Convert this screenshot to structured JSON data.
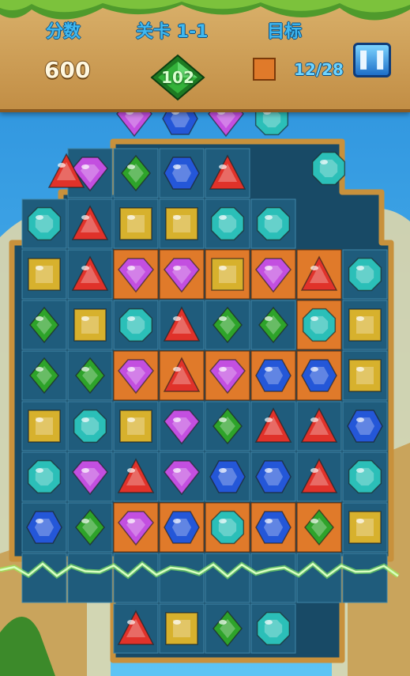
{
  "header": {
    "score_label": "分数",
    "score_value": "600",
    "level_label": "关卡 1-1",
    "goal_label": "目标",
    "moves_left": "102",
    "goal_progress": "12/28",
    "pause_icon": "pause-icon"
  },
  "colors": {
    "purple": "#c34fe0",
    "blue": "#2457d8",
    "teal": "#2bbfb8",
    "red": "#e0322a",
    "green": "#2ea32a",
    "yellow": "#d7b12d",
    "orange_tile": "#e07a2a",
    "board_cell": "#1f5c7c"
  },
  "board": {
    "grid": [
      ".PGBR..",
      "TRYYTT.",
      "YRPPYPRT",
      "GYTRGGTY",
      "GGPRPBBY",
      "YTYPGRRB",
      "TPRPBBRT",
      "BGPBTBGY",
      "........",
      "..RYGT.."
    ],
    "orange_cells": [
      [
        2,
        2
      ],
      [
        2,
        3
      ],
      [
        2,
        4
      ],
      [
        2,
        5
      ],
      [
        2,
        6
      ],
      [
        3,
        6
      ],
      [
        4,
        2
      ],
      [
        4,
        3
      ],
      [
        4,
        4
      ],
      [
        4,
        5
      ],
      [
        4,
        6
      ],
      [
        7,
        2
      ],
      [
        7,
        3
      ],
      [
        7,
        4
      ],
      [
        7,
        5
      ],
      [
        7,
        6
      ]
    ],
    "falling_gems": [
      "P",
      "B",
      "P",
      "T"
    ],
    "edge_gems": [
      {
        "type": "R",
        "row": 0,
        "col": 0
      },
      {
        "type": "T",
        "row": 0,
        "col": 6
      }
    ]
  }
}
